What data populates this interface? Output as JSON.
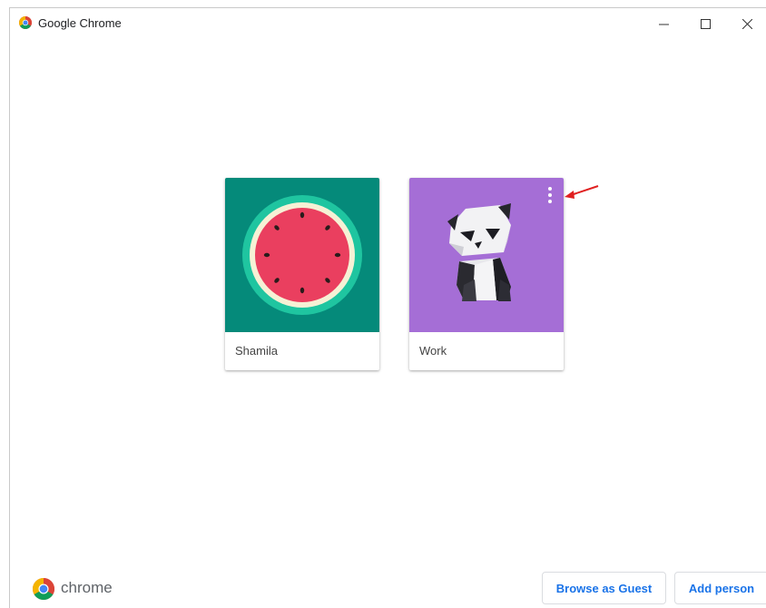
{
  "window": {
    "title": "Google Chrome"
  },
  "profiles": [
    {
      "name": "Shamila",
      "avatar": "watermelon-avatar"
    },
    {
      "name": "Work",
      "avatar": "origami-panda-avatar"
    }
  ],
  "footer": {
    "brand": "chrome",
    "browse_guest_label": "Browse as Guest",
    "add_person_label": "Add person"
  },
  "colors": {
    "accent": "#1a73e8",
    "watermelon_bg": "#058a7a",
    "panda_bg": "#a56ed6"
  },
  "icons": [
    "chrome-icon",
    "minimize-icon",
    "maximize-icon",
    "close-icon",
    "more-vert-icon",
    "red-arrow-annotation"
  ]
}
